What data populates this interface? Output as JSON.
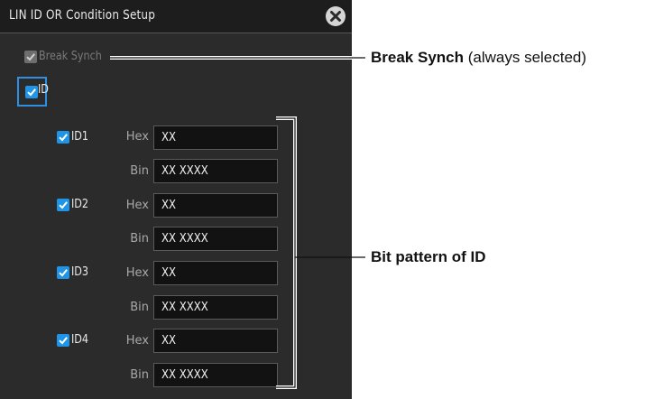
{
  "dialog": {
    "title": "LIN ID OR Condition Setup",
    "close_icon": "close-circle-icon",
    "break_synch_label": "Break Synch",
    "id_label": "ID",
    "ids": [
      {
        "label": "ID1",
        "hex_label": "Hex",
        "hex_value": "XX",
        "bin_label": "Bin",
        "bin_value": "XX XXXX"
      },
      {
        "label": "ID2",
        "hex_label": "Hex",
        "hex_value": "XX",
        "bin_label": "Bin",
        "bin_value": "XX XXXX"
      },
      {
        "label": "ID3",
        "hex_label": "Hex",
        "hex_value": "XX",
        "bin_label": "Bin",
        "bin_value": "XX XXXX"
      },
      {
        "label": "ID4",
        "hex_label": "Hex",
        "hex_value": "XX",
        "bin_label": "Bin",
        "bin_value": "XX XXXX"
      }
    ]
  },
  "annotations": {
    "break_synch_bold": "Break Synch",
    "break_synch_note": " (always selected)",
    "bit_pattern": "Bit pattern of ID"
  },
  "colors": {
    "dialog_bg": "#2b2b2b",
    "accent": "#1f95e8"
  }
}
